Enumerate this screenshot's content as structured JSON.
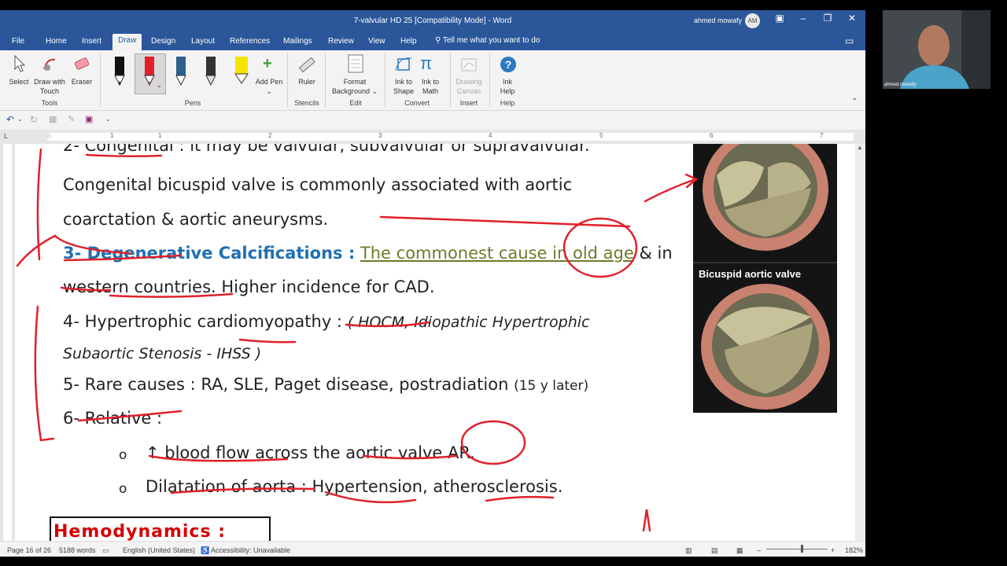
{
  "window": {
    "title": "7-valvular HD 25 [Compatibility Mode]  -  Word",
    "user_name": "ahmed mowafy",
    "user_initials": "AM"
  },
  "tabs": [
    "File",
    "Home",
    "Insert",
    "Draw",
    "Design",
    "Layout",
    "References",
    "Mailings",
    "Review",
    "View",
    "Help"
  ],
  "tell_me": "Tell me what you want to do",
  "ribbon": {
    "tools": {
      "select": "Select",
      "draw_touch": "Draw with Touch",
      "eraser": "Eraser",
      "group": "Tools"
    },
    "pens": {
      "group": "Pens",
      "add_pen": "Add Pen"
    },
    "stencils": {
      "ruler": "Ruler",
      "group": "Stencils"
    },
    "edit": {
      "format_background": "Format Background",
      "group": "Edit"
    },
    "convert": {
      "ink_to_shape": "Ink to Shape",
      "ink_to_math": "Ink to Math",
      "group": "Convert"
    },
    "insert": {
      "drawing_canvas": "Drawing Canvas",
      "group": "Insert"
    },
    "help": {
      "ink_help": "Ink Help",
      "group": "Help"
    }
  },
  "ruler_numbers": [
    "1",
    "1",
    "2",
    "3",
    "4",
    "5",
    "6",
    "7"
  ],
  "document": {
    "line0": "2- Congenital : it may be valvular, subvalvular or supravalvular.",
    "line1": "Congenital bicuspid valve is commonly associated with aortic",
    "line2": "coarctation & aortic aneurysms.",
    "line3_head": "3- Degenerative Calcifications :",
    "line3_olive": "The commonest cause in old age",
    "line3_tail": "& in",
    "line4": "western countries. Higher incidence for CAD.",
    "line5_a": "4- Hypertrophic cardiomyopathy :",
    "line5_b": "( HOCM, Idiopathic Hypertrophic",
    "line6": "Subaortic Stenosis - IHSS )",
    "line7_a": "5- Rare causes : RA, SLE, Paget disease, postradiation",
    "line7_b": "(15 y later)",
    "line8": "6- Relative :",
    "bullet1": "↑ blood flow across the aortic valve  AR.",
    "bullet2": "Dilatation of aorta : Hypertension, atherosclerosis.",
    "bullet_glyph": "o",
    "hemodynamics": "Hemodynamics :",
    "image_caption": "Bicuspid aortic valve"
  },
  "status": {
    "page": "Page 16 of 26",
    "words": "5188 words",
    "language": "English (United States)",
    "accessibility": "Accessibility: Unavailable",
    "zoom": "182%"
  },
  "webcam_label": "ahmed mowafy",
  "colors": {
    "accent": "#2b579a",
    "ink": "#e0202a",
    "heading_blue": "#1f6fb4",
    "olive": "#6b7c2a",
    "hemodynamics": "#d40000"
  }
}
